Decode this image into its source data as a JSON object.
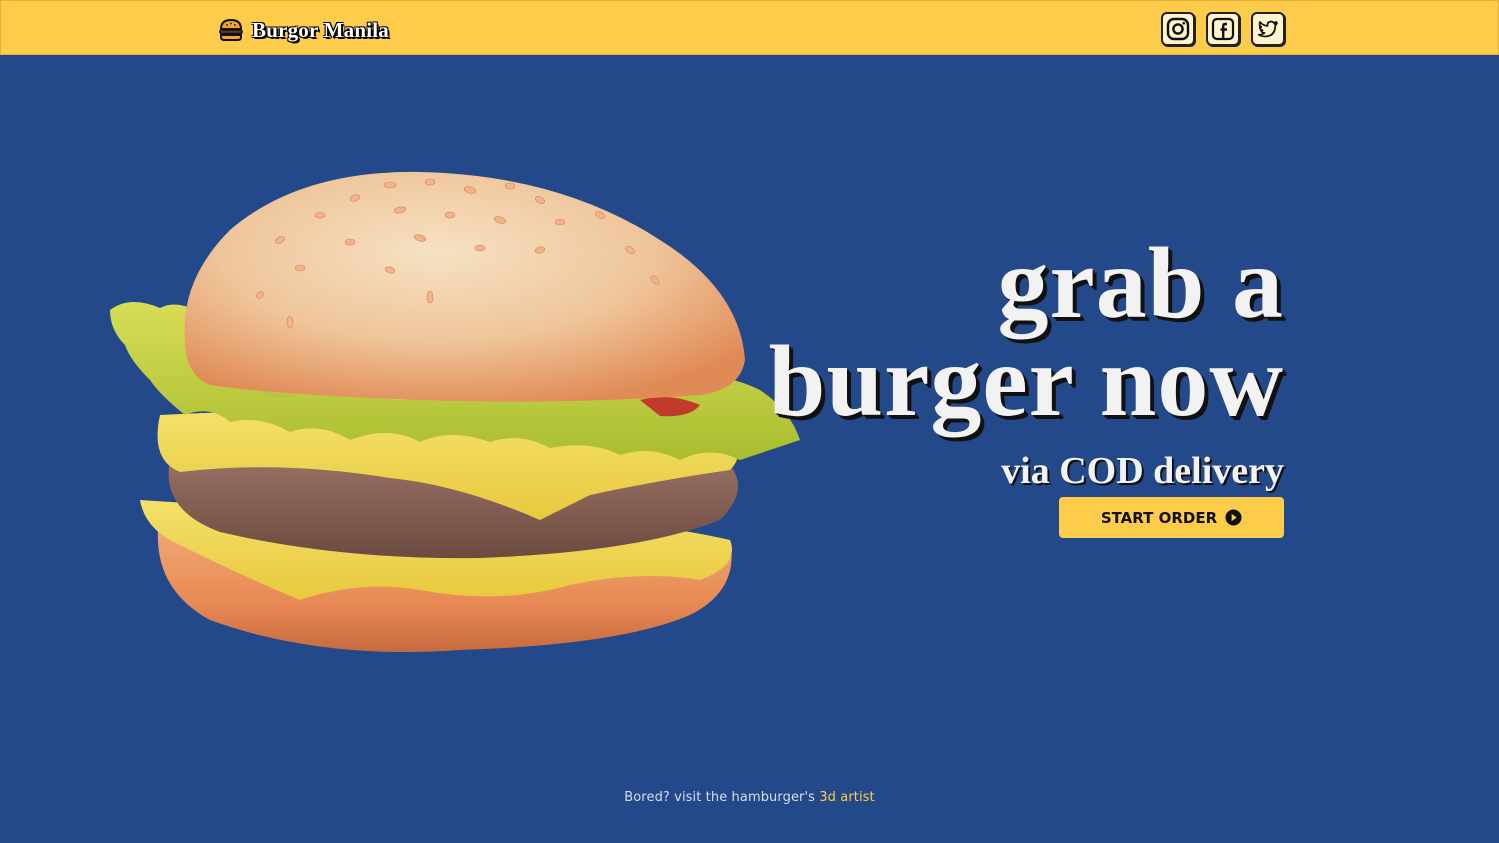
{
  "nav": {
    "brand": "Burgor Manila",
    "socials": [
      {
        "name": "instagram-icon"
      },
      {
        "name": "facebook-icon"
      },
      {
        "name": "twitter-icon"
      }
    ]
  },
  "hero": {
    "line1": "grab a",
    "line2": "burger now",
    "sub": "via COD delivery",
    "cta_label": "START ORDER",
    "cta_icon": "play-circle-icon"
  },
  "footer": {
    "text": "Bored? visit the hamburger's ",
    "link": "3d artist"
  },
  "colors": {
    "background": "#23498b",
    "accent": "#fecc4b"
  }
}
